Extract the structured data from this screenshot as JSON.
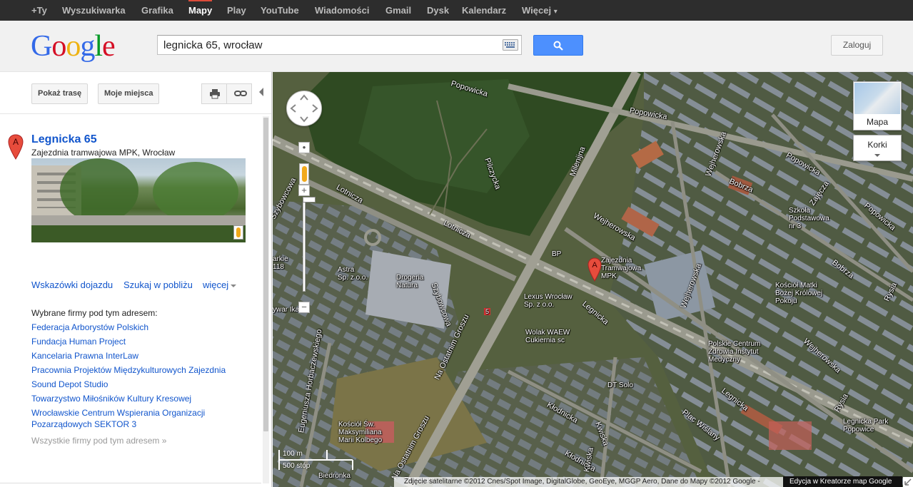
{
  "nav": {
    "items": [
      "+Ty",
      "Wyszukiwarka",
      "Grafika",
      "Mapy",
      "Play",
      "YouTube",
      "Wiadomości",
      "Gmail",
      "Dysk",
      "Kalendarz",
      "Więcej"
    ],
    "active": "Mapy",
    "more_arrow": "▾"
  },
  "header": {
    "logo": [
      "G",
      "o",
      "o",
      "g",
      "l",
      "e"
    ],
    "search_value": "legnicka 65, wrocław",
    "login_label": "Zaloguj"
  },
  "toolbar": {
    "directions_label": "Pokaż trasę",
    "my_places_label": "Moje miejsca",
    "print_icon": "print-icon",
    "link_icon": "link-icon"
  },
  "place": {
    "marker_letter": "A",
    "title": "Legnicka 65",
    "subtitle": "Zajezdnia tramwajowa MPK, Wrocław"
  },
  "actions": {
    "directions": "Wskazówki dojazdu",
    "nearby": "Szukaj w pobliżu",
    "more": "więcej"
  },
  "businesses": {
    "heading": "Wybrane firmy pod tym adresem:",
    "items": [
      "Federacja Arborystów Polskich",
      "Fundacja Human Project",
      "Kancelaria Prawna InterLaw",
      "Pracownia Projektów Międzykulturowych Zajezdnia",
      "Sound Depot Studio",
      "Towarzystwo Miłośników Kultury Kresowej",
      "Wrocławskie Centrum Wspierania Organizacji Pozarządowych SEKTOR 3"
    ],
    "all_link": "Wszystkie firmy pod tym adresem »"
  },
  "map": {
    "maptype_label": "Mapa",
    "traffic_label": "Korki",
    "marker_letter": "A",
    "scale_metric": "100 m",
    "scale_imperial": "500 stóp",
    "attribution": "Zdjęcie satelitarne ©2012 Cnes/Spot Image, DigitalGlobe, GeoEye, MGGP Aero, Dane do Mapy ©2012 Google -",
    "edit_link": "Edycja w Kreatorze map Google",
    "streets": {
      "popowicka_top": "Popowicka",
      "popowicka_mid": "Popowicka",
      "popowicka_right": "Popowicka",
      "popowicka_far": "Popowicka",
      "lotnicza1": "Lotnicza",
      "lotnicza2": "Lotnicza",
      "milenijna": "Milenijna",
      "wejherowska1": "Wejherowska",
      "wejherowska2": "Wejherowska",
      "wejherowska3": "Wejherowska",
      "wejherowska4": "Wejherowska",
      "bobrza1": "Bobrza",
      "bobrza2": "Bobrza",
      "zajecza": "Zajęcza",
      "rysia": "Rysia",
      "rysia2": "Rysia",
      "szybowcowa1": "Szybowcowa",
      "szybowcowa2": "Szybowcowa",
      "legnicka1": "Legnicka",
      "legnicka2": "Legnicka",
      "na_ostatnim_groszu": "Na Ostatnim Groszu",
      "na_ostatnim_groszu2": "Na Ostatnim Groszu",
      "horbaczewskiego": "Eugeniusza Horbaczewskiego",
      "klodnicka1": "Kłodnicka",
      "klodnicka2": "Kłodnicka",
      "kwiska1": "Kwiska",
      "kwiska2": "Kwiska",
      "plac_wislany": "Plac Wiślany",
      "pilczycka": "Pilczycka",
      "route_number": "5"
    },
    "pois": {
      "zajezdnia": "Zajezdnia\nTramwajowa\nMPK",
      "bp": "BP",
      "astra": "Astra\nSp. z o.o.",
      "drogeria": "Drogeria\nNatura",
      "lexus": "Lexus Wrocław\nSp. z o.o.",
      "wolak": "Wolak WAEW\nCukiernia sc",
      "szkola": "Szkoła\nPodstawowa\nnr 3",
      "kosciol_matki": "Kościół Matki\nBożej Królowej\nPokoju",
      "centrum": "Polskie Centrum\nZdrowia Instytut\nMedyczny",
      "dt_solo": "DT Solo",
      "kosciol_maks": "Kościół Św.\nMaksymiliana\nMarii Kolbego",
      "legnicka_park": "Legnicka Park\nPopowice",
      "biedronka": "Biedronka",
      "strzegom": "Strzegom",
      "ikar": "ywar Ikar",
      "parkie": "arkie\n118"
    }
  }
}
